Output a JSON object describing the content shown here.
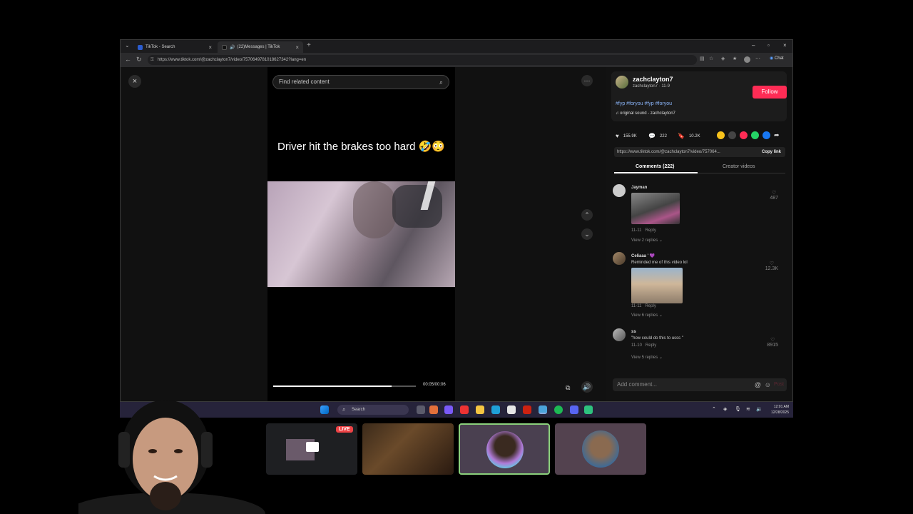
{
  "browser": {
    "tabs": [
      {
        "label": "TikTok - Search",
        "active": false
      },
      {
        "label": "(22)Messages | TikTok",
        "active": true
      }
    ],
    "url": "https://www.tiktok.com/@zachclayton7/video/7570649781018627342?lang=en",
    "copilot_label": "Chat"
  },
  "video": {
    "search_placeholder": "Find related content",
    "caption": "Driver hit the brakes too hard 🤣😳",
    "timecode": "00:05/00:06",
    "progress": 0.83
  },
  "author": {
    "display_name": "zachclayton7",
    "sub": "zachclayton7 · 11-9",
    "follow_label": "Follow",
    "hashtags": "#fyp #foryou #fyp #foryou",
    "sound": "original sound - zachclayton7"
  },
  "stats": {
    "likes": "155.9K",
    "comments": "222",
    "saves": "10.2K"
  },
  "share": {
    "link": "https://www.tiktok.com/@zachclayton7/video/757064...",
    "copy_label": "Copy link"
  },
  "panel_tabs": {
    "comments": "Comments (222)",
    "creator": "Creator videos"
  },
  "comments": [
    {
      "name": "Jayman",
      "text": "",
      "date": "11-11",
      "reply": "Reply",
      "replies": "View 2 replies",
      "likes": "487"
    },
    {
      "name": "Celiaaa ' 💜",
      "text": "Reminded me of this video lol",
      "date": "11-11",
      "reply": "Reply",
      "replies": "View 6 replies",
      "likes": "12.3K"
    },
    {
      "name": "ss",
      "text": "\"how could do this to usss \"",
      "date": "11-10",
      "reply": "Reply",
      "replies": "View 5 replies",
      "likes": "8915"
    }
  ],
  "add_comment": {
    "placeholder": "Add comment...",
    "post_label": "Post"
  },
  "taskbar": {
    "search_label": "Search",
    "time": "12:01 AM",
    "date": "12/28/2025"
  },
  "stream": {
    "live_label": "LIVE"
  },
  "colors": {
    "accent": "#fe2c55",
    "hashtag": "#8ab4f8",
    "taskbar": "#26233a"
  }
}
